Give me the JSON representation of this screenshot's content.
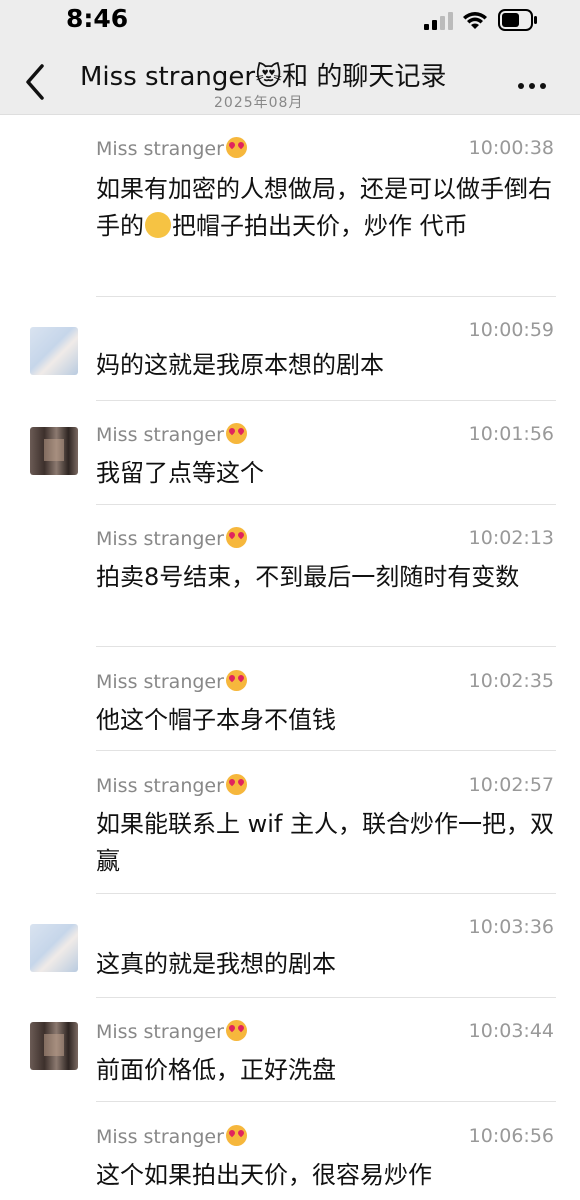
{
  "status_bar": {
    "time": "8:46"
  },
  "header": {
    "title": "Miss stranger😻和 的聊天记录",
    "subtitle": "2025年08月"
  },
  "messages": [
    {
      "sender": "Miss stranger",
      "time": "10:00:38",
      "text_before": "如果有加密的人想做局，还是可以做手倒右手的",
      "text_after": "把帽子拍出天价，炒作 代币",
      "avatar": "none",
      "show_sender": true
    },
    {
      "sender": "",
      "time": "10:00:59",
      "text": "妈的这就是我原本想的剧本",
      "avatar": "a",
      "show_sender": false
    },
    {
      "sender": "Miss stranger",
      "time": "10:01:56",
      "text": "我留了点等这个",
      "avatar": "b",
      "show_sender": true
    },
    {
      "sender": "Miss stranger",
      "time": "10:02:13",
      "text": "拍卖8号结束，不到最后一刻随时有变数",
      "avatar": "none",
      "show_sender": true
    },
    {
      "sender": "Miss stranger",
      "time": "10:02:35",
      "text": "他这个帽子本身不值钱",
      "avatar": "none",
      "show_sender": true
    },
    {
      "sender": "Miss stranger",
      "time": "10:02:57",
      "text": "如果能联系上 wif 主人，联合炒作一把，双赢",
      "avatar": "none",
      "show_sender": true
    },
    {
      "sender": "",
      "time": "10:03:36",
      "text": "这真的就是我想的剧本",
      "avatar": "a",
      "show_sender": false
    },
    {
      "sender": "Miss stranger",
      "time": "10:03:44",
      "text": "前面价格低，正好洗盘",
      "avatar": "b",
      "show_sender": true
    },
    {
      "sender": "Miss stranger",
      "time": "10:06:56",
      "text": "这个如果拍出天价，很容易炒作",
      "avatar": "none",
      "show_sender": true
    }
  ]
}
